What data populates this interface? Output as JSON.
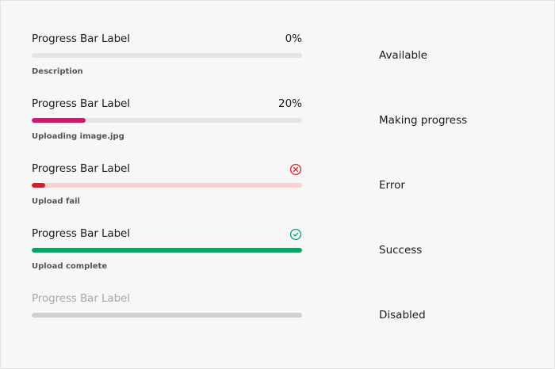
{
  "progress_bars": [
    {
      "label": "Progress Bar Label",
      "value_text": "0%",
      "progress": 0,
      "fill_color": "#e4e4e4",
      "track_color": "#e4e4e4",
      "description": "Description",
      "state": "Available"
    },
    {
      "label": "Progress Bar Label",
      "value_text": "20%",
      "progress": 0.2,
      "fill_color": "#d6156b",
      "track_color": "#e4e4e4",
      "description": "Uploading image.jpg",
      "state": "Making progress"
    },
    {
      "label": "Progress Bar Label",
      "status_icon": "error-x-circle-icon",
      "progress": 0.05,
      "fill_color": "#da1e28",
      "track_color": "#f8d2d2",
      "icon_color": "#da1e28",
      "description": "Upload fail",
      "state": "Error"
    },
    {
      "label": "Progress Bar Label",
      "status_icon": "success-check-circle-icon",
      "progress": 1,
      "fill_color": "#00a865",
      "track_color": "#e4e4e4",
      "icon_color": "#00a865",
      "description": "Upload complete",
      "state": "Success"
    },
    {
      "label": "Progress Bar Label",
      "progress": 0,
      "fill_color": "#d0d0d0",
      "track_color": "#d0d0d0",
      "label_color": "#a8a8a8",
      "state": "Disabled"
    }
  ]
}
